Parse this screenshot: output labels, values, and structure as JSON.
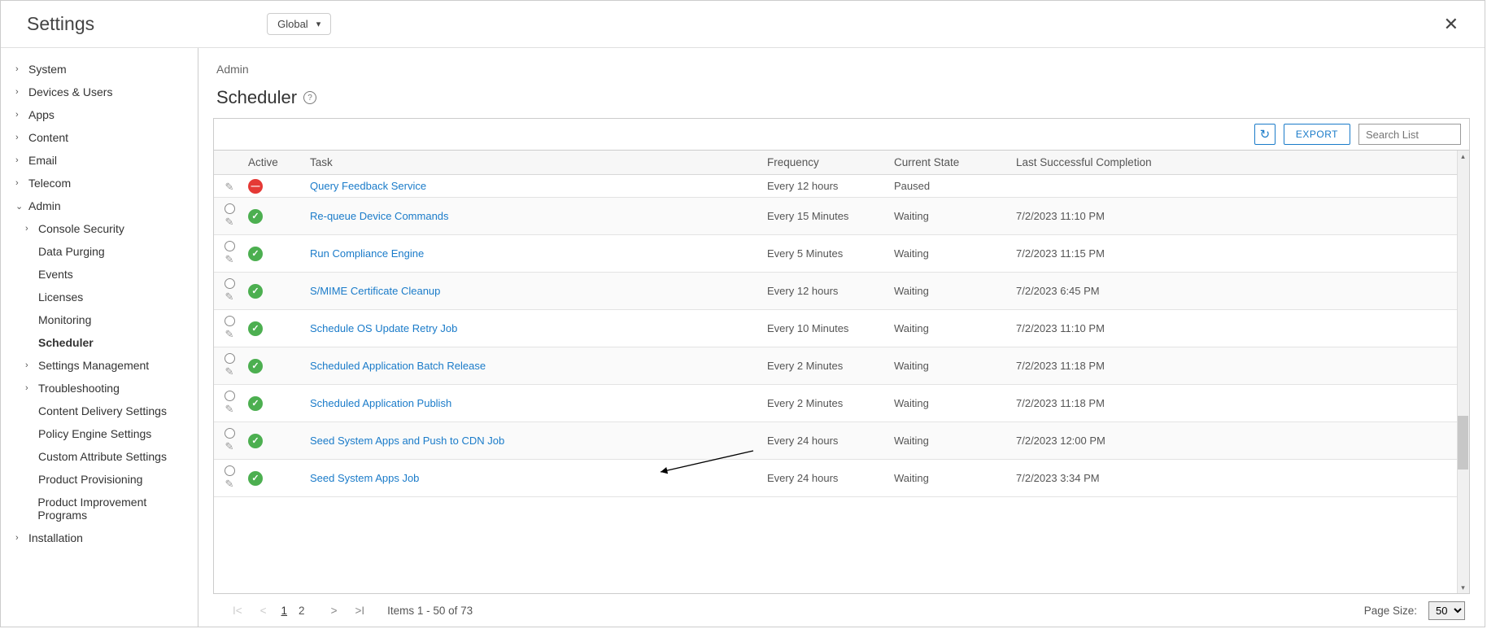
{
  "header": {
    "title": "Settings",
    "scope": "Global"
  },
  "sidebar": [
    {
      "label": "System",
      "expand": true
    },
    {
      "label": "Devices & Users",
      "expand": true
    },
    {
      "label": "Apps",
      "expand": true
    },
    {
      "label": "Content",
      "expand": true
    },
    {
      "label": "Email",
      "expand": true
    },
    {
      "label": "Telecom",
      "expand": true
    },
    {
      "label": "Admin",
      "expand": true,
      "open": true,
      "children": [
        {
          "label": "Console Security",
          "expand": true
        },
        {
          "label": "Data Purging"
        },
        {
          "label": "Events"
        },
        {
          "label": "Licenses"
        },
        {
          "label": "Monitoring"
        },
        {
          "label": "Scheduler",
          "current": true
        },
        {
          "label": "Settings Management",
          "expand": true
        },
        {
          "label": "Troubleshooting",
          "expand": true
        },
        {
          "label": "Content Delivery Settings"
        },
        {
          "label": "Policy Engine Settings"
        },
        {
          "label": "Custom Attribute Settings"
        },
        {
          "label": "Product Provisioning"
        },
        {
          "label": "Product Improvement Programs"
        }
      ]
    },
    {
      "label": "Installation",
      "expand": true
    }
  ],
  "breadcrumb": "Admin",
  "pageTitle": "Scheduler",
  "toolbar": {
    "exportLabel": "EXPORT",
    "searchPlaceholder": "Search List"
  },
  "columns": {
    "active": "Active",
    "task": "Task",
    "freq": "Frequency",
    "state": "Current State",
    "complete": "Last Successful Completion"
  },
  "rows": [
    {
      "status": "paused",
      "task": "Query Feedback Service",
      "freq": "Every 12 hours",
      "state": "Paused",
      "complete": "",
      "partial": true
    },
    {
      "status": "active",
      "task": "Re-queue Device Commands",
      "freq": "Every 15 Minutes",
      "state": "Waiting",
      "complete": "7/2/2023 11:10 PM"
    },
    {
      "status": "active",
      "task": "Run Compliance Engine",
      "freq": "Every 5 Minutes",
      "state": "Waiting",
      "complete": "7/2/2023 11:15 PM"
    },
    {
      "status": "active",
      "task": "S/MIME Certificate Cleanup",
      "freq": "Every 12 hours",
      "state": "Waiting",
      "complete": "7/2/2023 6:45 PM"
    },
    {
      "status": "active",
      "task": "Schedule OS Update Retry Job",
      "freq": "Every 10 Minutes",
      "state": "Waiting",
      "complete": "7/2/2023 11:10 PM"
    },
    {
      "status": "active",
      "task": "Scheduled Application Batch Release",
      "freq": "Every 2 Minutes",
      "state": "Waiting",
      "complete": "7/2/2023 11:18 PM"
    },
    {
      "status": "active",
      "task": "Scheduled Application Publish",
      "freq": "Every 2 Minutes",
      "state": "Waiting",
      "complete": "7/2/2023 11:18 PM"
    },
    {
      "status": "active",
      "task": "Seed System Apps and Push to CDN Job",
      "freq": "Every 24 hours",
      "state": "Waiting",
      "complete": "7/2/2023 12:00 PM"
    },
    {
      "status": "active",
      "task": "Seed System Apps Job",
      "freq": "Every 24 hours",
      "state": "Waiting",
      "complete": "7/2/2023 3:34 PM"
    }
  ],
  "pager": {
    "pages": [
      "1",
      "2"
    ],
    "current": "1",
    "summary": "Items 1 - 50 of 73",
    "pageSizeLabel": "Page Size:",
    "pageSize": "50"
  }
}
